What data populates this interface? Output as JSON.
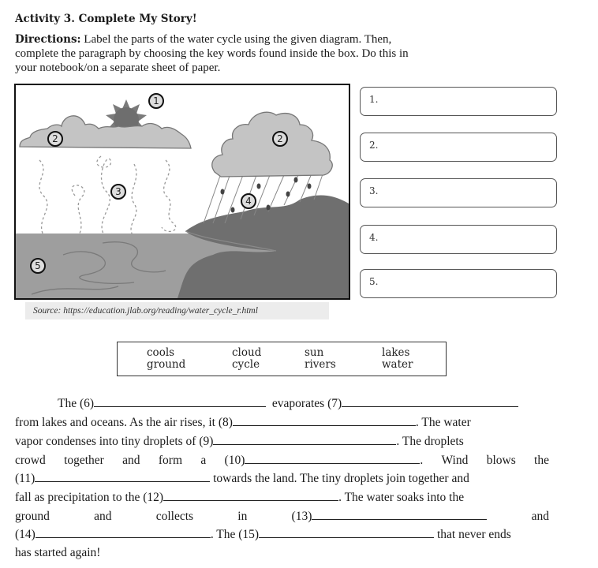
{
  "title": "Activity 3. Complete My Story!",
  "directions": {
    "label": "Directions:",
    "line1": "Label the parts of the water cycle using the given diagram. Then,",
    "line2": "complete the paragraph by choosing the key words found inside the box. Do this in",
    "line3": "your notebook/on a separate sheet of paper."
  },
  "diagram": {
    "markers": [
      "1",
      "2",
      "2",
      "3",
      "4",
      "5"
    ],
    "source": "Source: https://education.jlab.org/reading/water_cycle_r.html"
  },
  "label_boxes": [
    "1.",
    "2.",
    "3.",
    "4.",
    "5."
  ],
  "word_box": {
    "words": [
      "cools",
      "ground",
      "cloud",
      "cycle",
      "sun",
      "rivers",
      "lakes",
      "water"
    ]
  },
  "paragraph": {
    "l1": {
      "a": "The (6)",
      "b": "evaporates (7)"
    },
    "l2": {
      "a": "from lakes and oceans. As the air rises, it (8)",
      "b": ". The water"
    },
    "l3": {
      "a": "vapor condenses into tiny droplets of (9)",
      "b": ". The droplets"
    },
    "l4": {
      "w": [
        "crowd",
        "together",
        "and",
        "form",
        "a",
        "(10)"
      ],
      "b": ".",
      "c": [
        "Wind",
        "blows",
        "the"
      ]
    },
    "l5": {
      "a": "(11)",
      "b": "towards the land. The tiny droplets join together and"
    },
    "l6": {
      "a": "fall as precipitation to the (12)",
      "b": ". The water soaks into the"
    },
    "l7": {
      "w": [
        "ground",
        "and",
        "collects",
        "in",
        "(13)"
      ],
      "b": "and"
    },
    "l8": {
      "a": "(14)",
      "b": ". The (15)",
      "c": "that never ends"
    },
    "l9": {
      "a": "has started again!"
    }
  }
}
